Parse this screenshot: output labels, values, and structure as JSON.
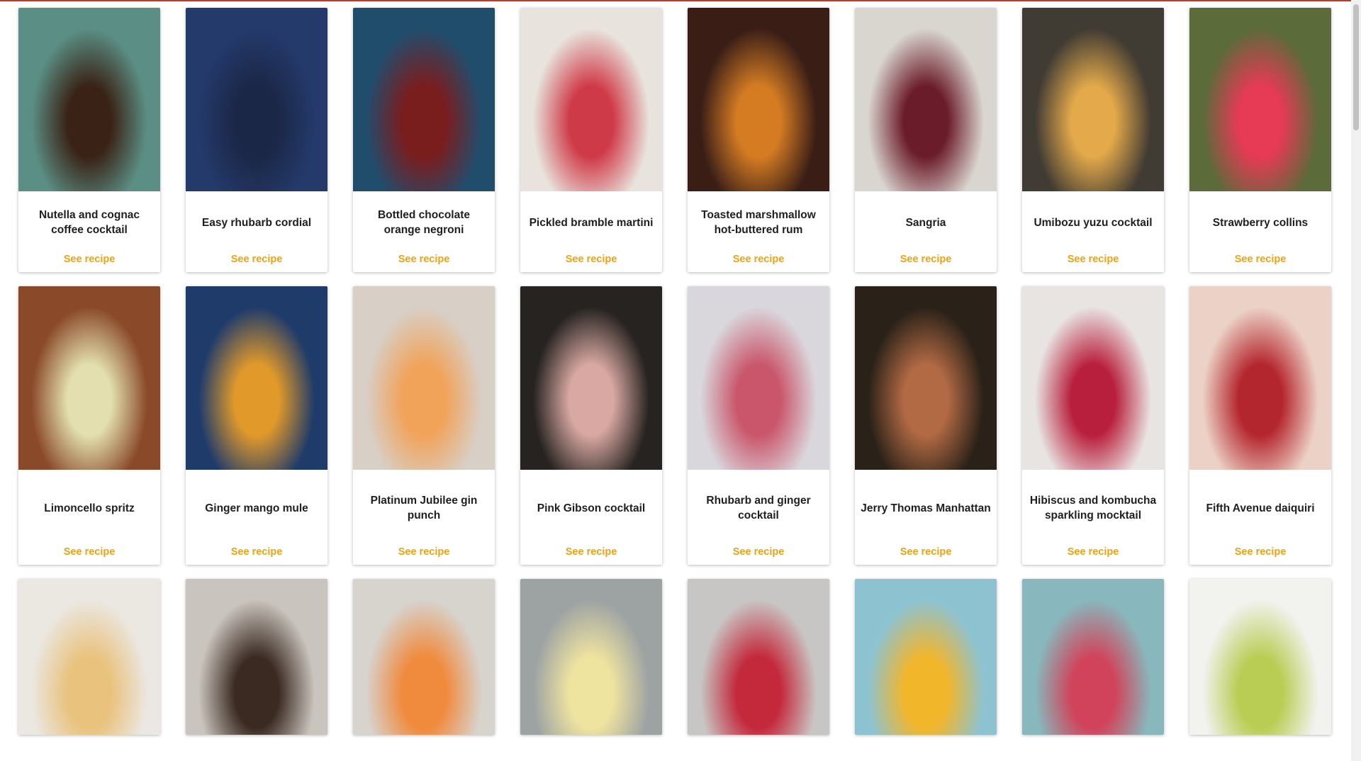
{
  "see_recipe": "See recipe",
  "rows": [
    [
      {
        "title": "Nutella and cognac coffee cocktail",
        "image": "hot-chocolate-mug-photo",
        "bg": [
          "#5b8f85",
          "#3a2216"
        ]
      },
      {
        "title": "Easy rhubarb cordial",
        "image": "pink-cordial-bottles-photo",
        "bg": [
          "#243a6b",
          "#1b2747"
        ]
      },
      {
        "title": "Bottled chocolate orange negroni",
        "image": "bottled-negroni-photo",
        "bg": [
          "#214d6d",
          "#7a1d1d"
        ]
      },
      {
        "title": "Pickled bramble martini",
        "image": "red-martini-glass-photo",
        "bg": [
          "#e8e3dc",
          "#cf3a48"
        ]
      },
      {
        "title": "Toasted marshmallow hot-buttered rum",
        "image": "hot-buttered-rum-mug-photo",
        "bg": [
          "#3a1e16",
          "#d57c23"
        ]
      },
      {
        "title": "Sangria",
        "image": "sangria-jug-photo",
        "bg": [
          "#d9d5cf",
          "#6b1c2a"
        ]
      },
      {
        "title": "Umibozu yuzu cocktail",
        "image": "yuzu-cocktail-seaweed-photo",
        "bg": [
          "#403b33",
          "#e3a94a"
        ]
      },
      {
        "title": "Strawberry collins",
        "image": "strawberry-collins-photo",
        "bg": [
          "#5b6b3a",
          "#e63a55"
        ]
      }
    ],
    [
      {
        "title": "Limoncello spritz",
        "image": "limoncello-spritz-photo",
        "bg": [
          "#8a4a2a",
          "#e3dfae"
        ]
      },
      {
        "title": "Ginger mango mule",
        "image": "ginger-mango-mule-photo",
        "bg": [
          "#1e3b6a",
          "#e19a2a"
        ]
      },
      {
        "title": "Platinum Jubilee gin punch",
        "image": "gin-punch-bowl-photo",
        "bg": [
          "#d8cfc6",
          "#f1a35a"
        ]
      },
      {
        "title": "Pink Gibson cocktail",
        "image": "pink-gibson-martini-photo",
        "bg": [
          "#262320",
          "#d9a8a2"
        ]
      },
      {
        "title": "Rhubarb and ginger cocktail",
        "image": "rhubarb-ginger-coupes-photo",
        "bg": [
          "#d9d7dc",
          "#c9566b"
        ]
      },
      {
        "title": "Jerry Thomas Manhattan",
        "image": "manhattan-glass-photo",
        "bg": [
          "#2a2118",
          "#b26a44"
        ]
      },
      {
        "title": "Hibiscus and kombucha sparkling mocktail",
        "image": "hibiscus-mocktail-photo",
        "bg": [
          "#e8e4e2",
          "#b81f3c"
        ]
      },
      {
        "title": "Fifth Avenue daiquiri",
        "image": "fifth-avenue-daiquiri-photo",
        "bg": [
          "#ecd2c6",
          "#b4262e"
        ]
      }
    ],
    [
      {
        "title": "",
        "image": "whisky-tumbler-photo",
        "bg": [
          "#ebe7e1",
          "#e9c27d"
        ]
      },
      {
        "title": "",
        "image": "espresso-martinis-photo",
        "bg": [
          "#c9c4bd",
          "#3a2a22"
        ]
      },
      {
        "title": "",
        "image": "passion-fruit-martini-photo",
        "bg": [
          "#d7d3cd",
          "#f08a3c"
        ]
      },
      {
        "title": "",
        "image": "pale-sour-cocktail-photo",
        "bg": [
          "#9da3a3",
          "#efe3a0"
        ]
      },
      {
        "title": "",
        "image": "red-highball-photo",
        "bg": [
          "#c8c6c4",
          "#c3283b"
        ]
      },
      {
        "title": "",
        "image": "mango-margarita-photo",
        "bg": [
          "#8dc3d1",
          "#f2b62b"
        ]
      },
      {
        "title": "",
        "image": "raspberry-margarita-photo",
        "bg": [
          "#88b8bd",
          "#d1435a"
        ]
      },
      {
        "title": "",
        "image": "cucumber-highball-photo",
        "bg": [
          "#f2f2ee",
          "#b9cd54"
        ]
      }
    ]
  ]
}
